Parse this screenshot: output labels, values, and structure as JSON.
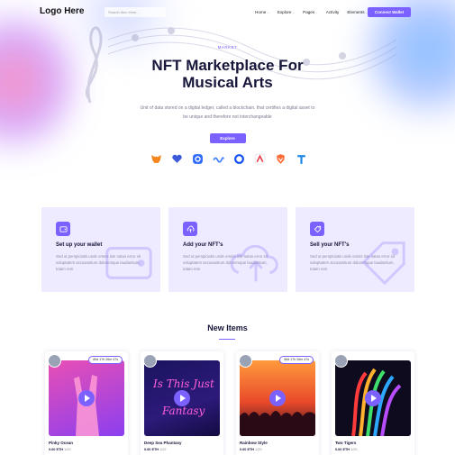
{
  "header": {
    "logo": "Logo Here",
    "search_placeholder": "Search Item Here...",
    "nav": [
      "Home",
      "Explore",
      "Pages",
      "Activity",
      "Elements"
    ],
    "connect_label": "Connect Wallet"
  },
  "hero": {
    "badge": "MARKET",
    "title": "NFT Marketplace For Musical Arts",
    "description": "Unit of data stored on a digital ledger, called a blockchain, that certifies a digital asset to be unique and therefore not interchangeable",
    "explore_label": "Explore",
    "wallet_icons": [
      "metamask-icon",
      "heart-wallet-icon",
      "coinbase-icon",
      "wave-icon",
      "circle-icon",
      "arrow-up-icon",
      "shield-icon",
      "t-icon"
    ]
  },
  "features": [
    {
      "title": "Set up your wallet",
      "text": "Sed ut perspiciatis unde omnis iste natus error sit voluptatem accusantium doloremque laudantium, totam rem",
      "icon": "wallet-icon"
    },
    {
      "title": "Add your NFT's",
      "text": "Sed ut perspiciatis unde omnis iste natus error sit voluptatem accusantium doloremque laudantium, totam rem",
      "icon": "upload-cloud-icon"
    },
    {
      "title": "Sell your NFT's",
      "text": "Sed ut perspiciatis unde omnis iste natus error sit voluptatem accusantium doloremque laudantium, totam rem",
      "icon": "tag-icon"
    }
  ],
  "new_items": {
    "title": "New Items",
    "items": [
      {
        "name": "Pinky Ocean",
        "timer": "85d 17h 26m 47s",
        "price_label": "0.00 ETH",
        "count": "1/20"
      },
      {
        "name": "Deep Sea Phantasy",
        "timer": "",
        "price_label": "0.00 ETH",
        "count": "1/22"
      },
      {
        "name": "Rainbow Style",
        "timer": "56d 17h 26m 47s",
        "price_label": "0.00 ETH",
        "count": "1/20"
      },
      {
        "name": "Two Tigers",
        "timer": "",
        "price_label": "0.00 ETH",
        "count": "1/20"
      }
    ]
  },
  "colors": {
    "accent": "#7b61ff",
    "card_bg": "#eeeaff",
    "heading": "#16163a"
  }
}
